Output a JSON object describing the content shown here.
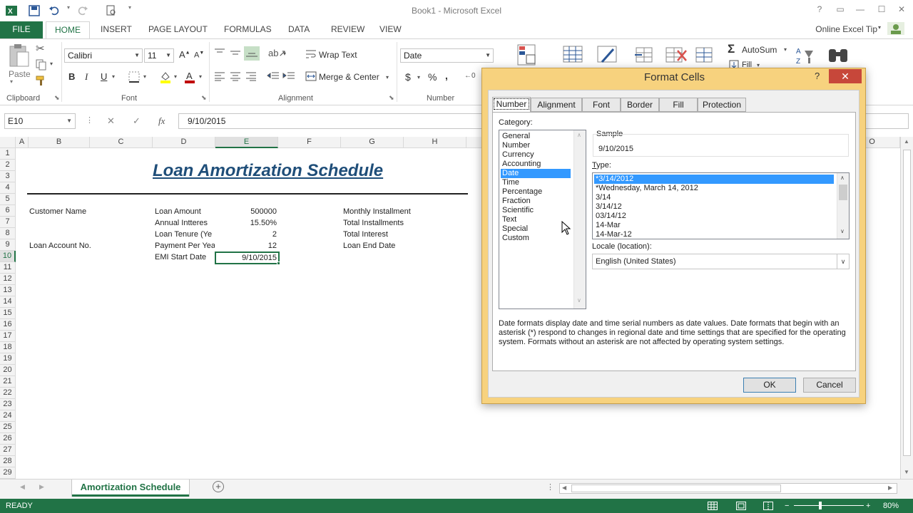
{
  "window": {
    "title": "Book1 - Microsoft Excel",
    "help": "?",
    "account": "Online Excel Tip"
  },
  "tabs": {
    "file": "FILE",
    "home": "HOME",
    "insert": "INSERT",
    "page_layout": "PAGE LAYOUT",
    "formulas": "FORMULAS",
    "data": "DATA",
    "review": "REVIEW",
    "view": "VIEW"
  },
  "ribbon": {
    "clipboard": {
      "label": "Clipboard",
      "paste": "Paste"
    },
    "font": {
      "label": "Font",
      "name": "Calibri",
      "size": "11",
      "bold": "B",
      "italic": "I",
      "underline": "U"
    },
    "alignment": {
      "label": "Alignment",
      "wrap": "Wrap Text",
      "merge": "Merge & Center"
    },
    "number": {
      "label": "Number",
      "format": "Date",
      "currency": "$",
      "percent": "%",
      "comma": ","
    },
    "editing": {
      "autosum": "AutoSum",
      "fill": "Fill"
    }
  },
  "formula_bar": {
    "name_box": "E10",
    "fx": "fx",
    "value": "9/10/2015"
  },
  "columns": [
    "A",
    "B",
    "C",
    "D",
    "E",
    "F",
    "G",
    "H",
    "O"
  ],
  "rows": [
    "1",
    "2",
    "3",
    "4",
    "5",
    "6",
    "7",
    "8",
    "9",
    "10",
    "11",
    "12",
    "13",
    "14",
    "15",
    "16",
    "17",
    "18",
    "19",
    "20",
    "21",
    "22",
    "23",
    "24",
    "25",
    "26",
    "27",
    "28",
    "29"
  ],
  "sheet": {
    "title": "Loan Amortization Schedule",
    "customer_name": "Customer Name",
    "loan_account": "Loan Account No.",
    "loan_amount_label": "Loan Amount",
    "loan_amount": "500000",
    "interest_label": "Annual Intteres",
    "interest": "15.50%",
    "tenure_label": "Loan Tenure (Ye",
    "tenure": "2",
    "payment_label": "Payment Per Yea",
    "payment": "12",
    "emi_label": "EMI Start Date",
    "emi": "9/10/2015",
    "monthly_installment": "Monthly Installment",
    "total_installments": "Total Installments",
    "total_interest": "Total Interest",
    "loan_end_date": "Loan End Date"
  },
  "sheet_tab": "Amortization Schedule",
  "status": {
    "ready": "READY",
    "zoom": "80%"
  },
  "dialog": {
    "title": "Format Cells",
    "help": "?",
    "tabs": [
      "Number",
      "Alignment",
      "Font",
      "Border",
      "Fill",
      "Protection"
    ],
    "category_label": "Category:",
    "categories": [
      "General",
      "Number",
      "Currency",
      "Accounting",
      "Date",
      "Time",
      "Percentage",
      "Fraction",
      "Scientific",
      "Text",
      "Special",
      "Custom"
    ],
    "selected_category": "Date",
    "sample_label": "Sample",
    "sample_value": "9/10/2015",
    "type_label": "Type:",
    "types": [
      "*3/14/2012",
      "*Wednesday, March 14, 2012",
      "3/14",
      "3/14/12",
      "03/14/12",
      "14-Mar",
      "14-Mar-12"
    ],
    "locale_label": "Locale (location):",
    "locale": "English (United States)",
    "description": "Date formats display date and time serial numbers as date values.  Date formats that begin with an asterisk (*) respond to changes in regional date and time settings that are specified for the operating system. Formats without an asterisk are not affected by operating system settings.",
    "ok": "OK",
    "cancel": "Cancel"
  },
  "colors": {
    "excel_green": "#217346",
    "dialog_frame": "#f7d27e",
    "title_blue": "#1f4e79",
    "selection": "#3399ff",
    "close_red": "#c7473a"
  }
}
